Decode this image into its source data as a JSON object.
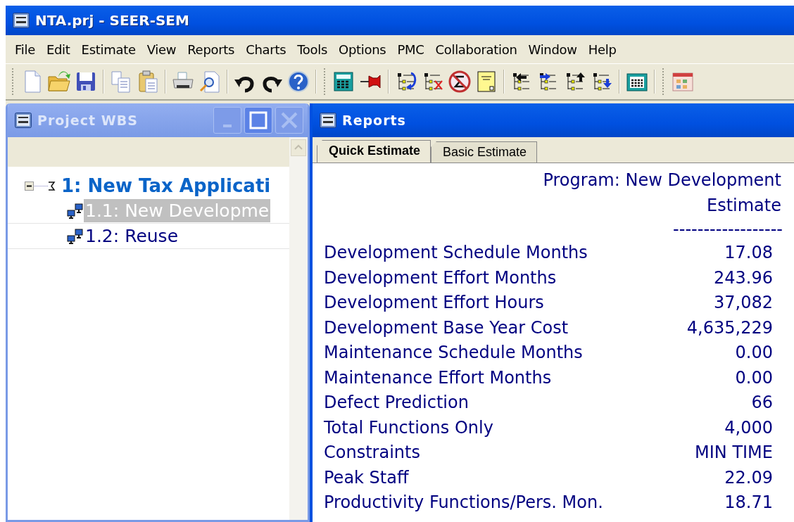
{
  "window": {
    "title": "NTA.prj - SEER-SEM"
  },
  "menu": [
    "File",
    "Edit",
    "Estimate",
    "View",
    "Reports",
    "Charts",
    "Tools",
    "Options",
    "PMC",
    "Collaboration",
    "Window",
    "Help"
  ],
  "wbs_panel": {
    "title": "Project WBS",
    "active": false,
    "tree": [
      {
        "label": "1: New Tax Applicati",
        "expanded": true,
        "selected": false,
        "children": [
          {
            "label": "1.1: New Developme",
            "selected": true
          },
          {
            "label": "1.2: Reuse",
            "selected": false
          }
        ]
      }
    ]
  },
  "reports_panel": {
    "title": "Reports",
    "active": true,
    "tabs": [
      {
        "label": "Quick Estimate",
        "selected": true
      },
      {
        "label": "Basic Estimate",
        "selected": false
      }
    ],
    "heading": [
      "Program: New Development",
      "Estimate"
    ],
    "separator": "------------------",
    "rows": [
      {
        "label": "Development Schedule Months",
        "value": "17.08"
      },
      {
        "label": "Development Effort Months",
        "value": "243.96"
      },
      {
        "label": "Development Effort Hours",
        "value": "37,082"
      },
      {
        "label": "Development Base Year Cost",
        "value": "4,635,229"
      },
      {
        "label": "Maintenance Schedule Months",
        "value": "0.00"
      },
      {
        "label": "Maintenance Effort Months",
        "value": "0.00"
      },
      {
        "label": "Defect Prediction",
        "value": "66"
      },
      {
        "label": "Total Functions Only",
        "value": "4,000"
      },
      {
        "label": "Constraints",
        "value": "MIN TIME"
      },
      {
        "label": "Peak Staff",
        "value": "22.09"
      },
      {
        "label": "Productivity Functions/Pers. Mon.",
        "value": "18.71"
      }
    ]
  }
}
